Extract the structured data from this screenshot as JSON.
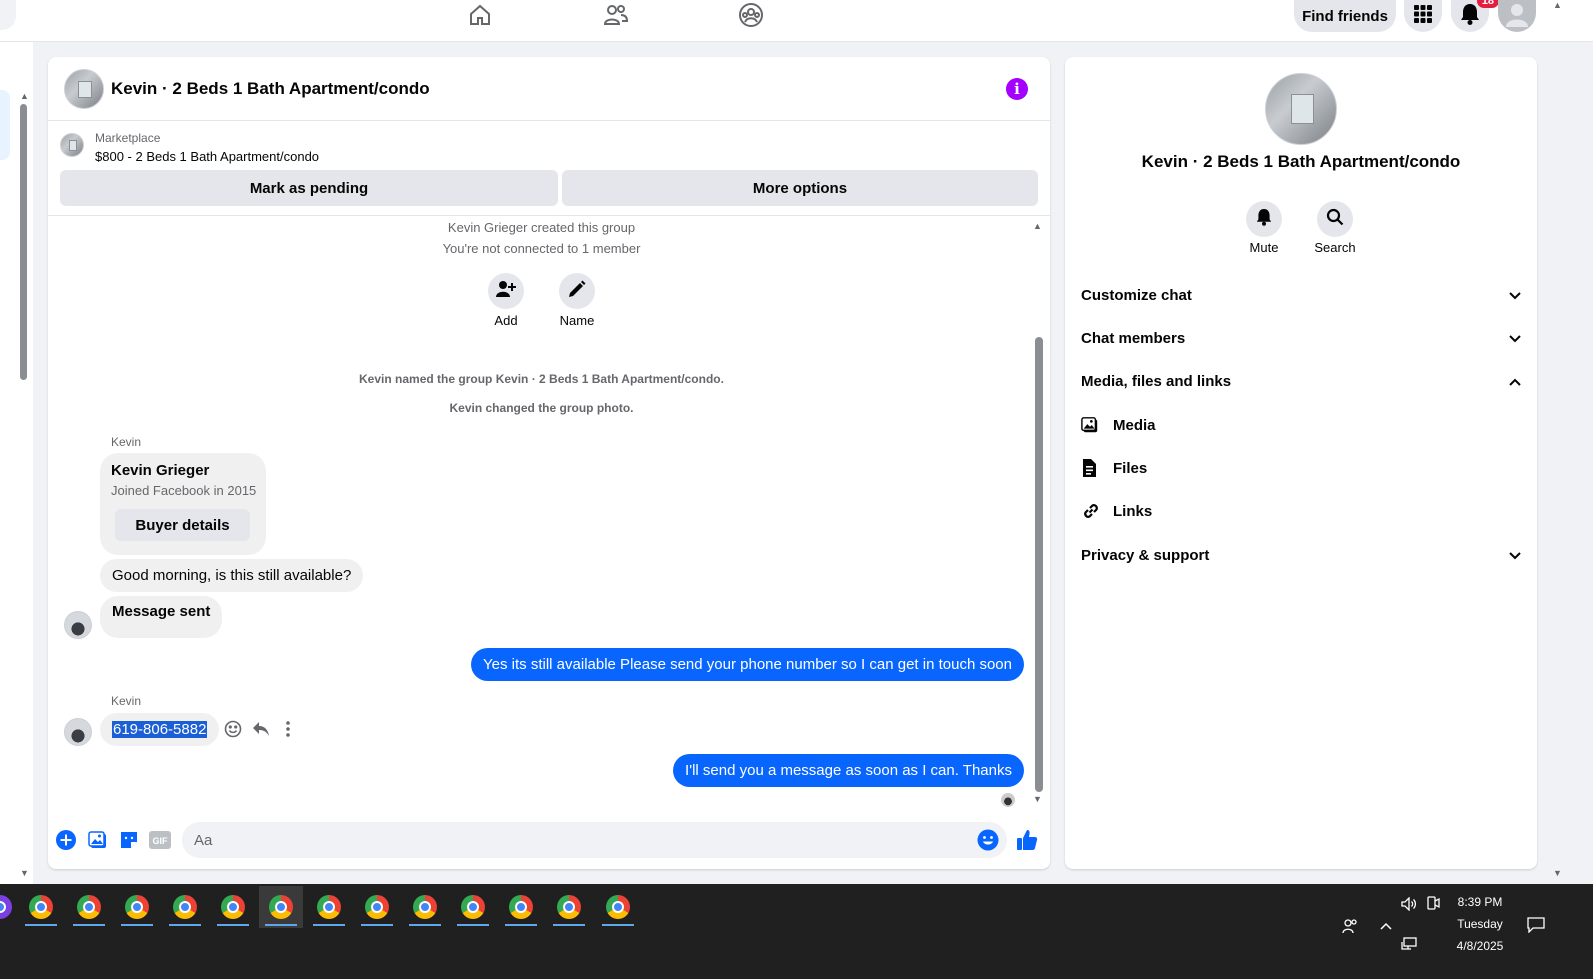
{
  "topbar": {
    "find_friends": "Find friends",
    "notification_count": "18"
  },
  "chat": {
    "title": "Kevin · 2 Beds 1 Bath Apartment/condo",
    "marketplace_label": "Marketplace",
    "listing": "$800 - 2 Beds 1 Bath Apartment/condo",
    "mark_pending": "Mark as pending",
    "more_options": "More options",
    "system": {
      "created": "Kevin Grieger created this group",
      "not_connected": "You're not connected to 1 member",
      "add_label": "Add",
      "name_label": "Name",
      "named": "Kevin named the group Kevin · 2 Beds 1 Bath Apartment/condo.",
      "photo": "Kevin changed the group photo."
    },
    "card": {
      "sender": "Kevin",
      "name": "Kevin Grieger",
      "joined": "Joined Facebook in 2015",
      "button": "Buyer details"
    },
    "messages": {
      "in_1": "Good morning, is this still available?",
      "in_2": "Message sent",
      "out_1": "Yes its still available Please send your phone number so I can get in touch soon",
      "sender_2": "Kevin",
      "in_3": "619-806-5882",
      "out_2": "I'll send you a message as soon as I can. Thanks"
    },
    "composer_placeholder": "Aa"
  },
  "info": {
    "title": "Kevin · 2 Beds 1 Bath Apartment/condo",
    "mute": "Mute",
    "search": "Search",
    "customize": "Customize chat",
    "members": "Chat members",
    "media_section": "Media, files and links",
    "media": "Media",
    "files": "Files",
    "links": "Links",
    "privacy": "Privacy & support"
  },
  "taskbar": {
    "time": "8:39 PM",
    "day": "Tuesday",
    "date": "4/8/2025"
  },
  "colors": {
    "accent": "#0866ff",
    "info": "#a400ff",
    "bubble_in": "#f0f0f0"
  }
}
